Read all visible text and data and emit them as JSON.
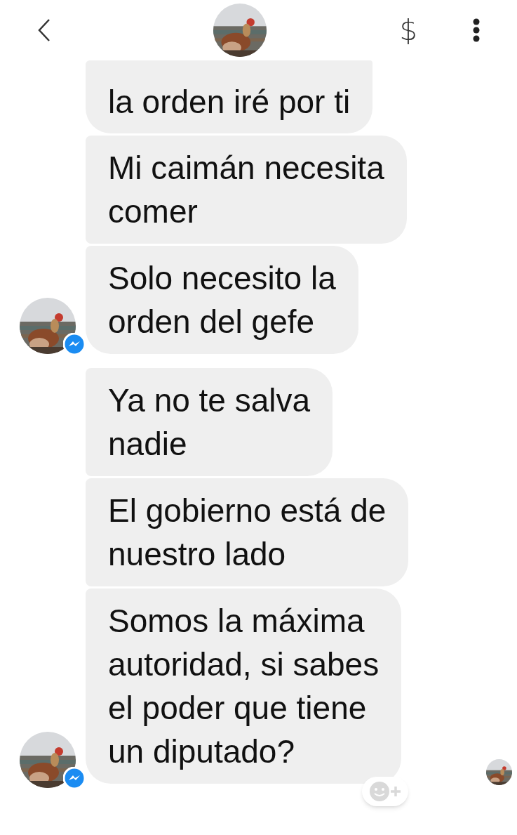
{
  "header": {
    "payment_symbol": "$"
  },
  "groups": [
    {
      "messages": [
        "la orden iré por ti",
        "Mi caimán necesita\ncomer",
        "Solo necesito la\norden del gefe"
      ],
      "seen": false
    },
    {
      "messages": [
        "Ya no te salva\nnadie",
        "El gobierno está de\nnuestro lado",
        "Somos la máxima\nautoridad,  si sabes\nel poder que tiene\nun diputado?"
      ],
      "seen": true
    }
  ]
}
